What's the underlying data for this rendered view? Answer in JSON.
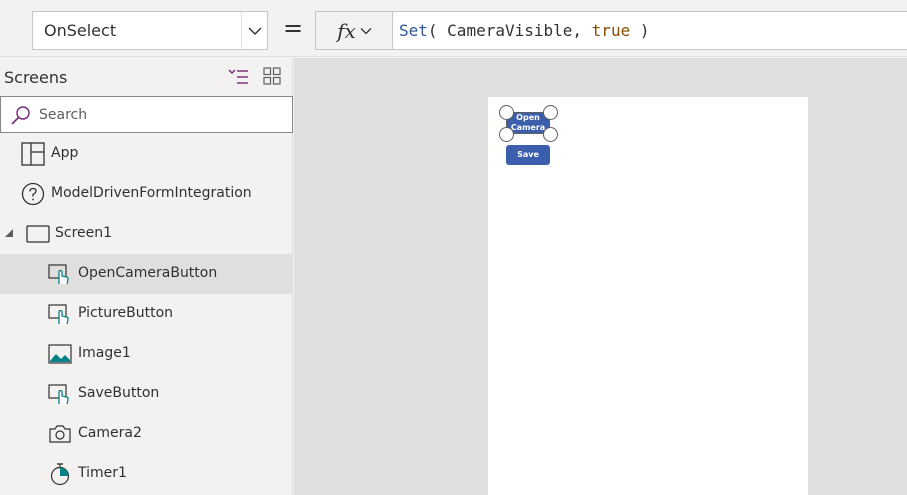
{
  "formula_bar": {
    "property": "OnSelect",
    "equals": "=",
    "fx_label": "fx",
    "formula": {
      "fn": "Set",
      "open": "( ",
      "arg": "CameraVisible, ",
      "bool": "true",
      "close": " )"
    }
  },
  "tree": {
    "title": "Screens",
    "search_placeholder": "Search",
    "items": [
      {
        "label": "App",
        "icon": "app-icon"
      },
      {
        "label": "ModelDrivenFormIntegration",
        "icon": "question-icon"
      },
      {
        "label": "Screen1",
        "icon": "screen-icon"
      },
      {
        "label": "OpenCameraButton",
        "icon": "button-icon",
        "selected": true
      },
      {
        "label": "PictureButton",
        "icon": "picture-button-icon"
      },
      {
        "label": "Image1",
        "icon": "image-icon"
      },
      {
        "label": "SaveButton",
        "icon": "button-icon"
      },
      {
        "label": "Camera2",
        "icon": "camera-icon"
      },
      {
        "label": "Timer1",
        "icon": "timer-icon"
      }
    ]
  },
  "canvas": {
    "open_button_label": "Open Camera",
    "save_button_label": "Save"
  },
  "colors": {
    "accent": "#742774",
    "button": "#3b5ead",
    "teal": "#038387"
  }
}
